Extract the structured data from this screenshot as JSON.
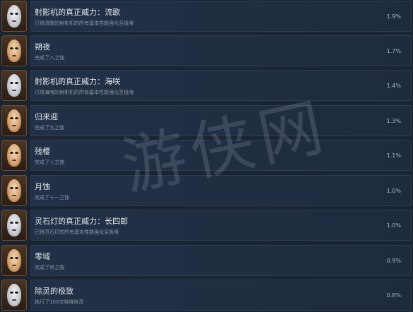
{
  "achievements": [
    {
      "title": "射影机的真正威力：流歌",
      "desc": "已将流歌的射影机的所有基本性能强化至极限",
      "pct": "1.9%",
      "icon": "mask-white"
    },
    {
      "title": "朔夜",
      "desc": "完成了八之蚀",
      "pct": "1.7%",
      "icon": "mask-gold"
    },
    {
      "title": "射影机的真正威力：海咲",
      "desc": "已将海咲的射影机的所有基本性能强化至极限",
      "pct": "1.4%",
      "icon": "mask-white"
    },
    {
      "title": "归来迎",
      "desc": "完成了九之蚀",
      "pct": "1.3%",
      "icon": "mask-gold"
    },
    {
      "title": "残樱",
      "desc": "完成了十之蚀",
      "pct": "1.1%",
      "icon": "mask-gold"
    },
    {
      "title": "月蚀",
      "desc": "完成了十一之蚀",
      "pct": "1.0%",
      "icon": "mask-gold"
    },
    {
      "title": "灵石灯的真正威力：长四郎",
      "desc": "已将灵石灯的所有基本性能强化至极限",
      "pct": "1.0%",
      "icon": "mask-white"
    },
    {
      "title": "零域",
      "desc": "完成了终之蚀",
      "pct": "0.9%",
      "icon": "mask-gold"
    },
    {
      "title": "除灵的极致",
      "desc": "执行了100次特殊除灵",
      "pct": "0.8%",
      "icon": "mask-white"
    }
  ],
  "watermark": "游侠网"
}
